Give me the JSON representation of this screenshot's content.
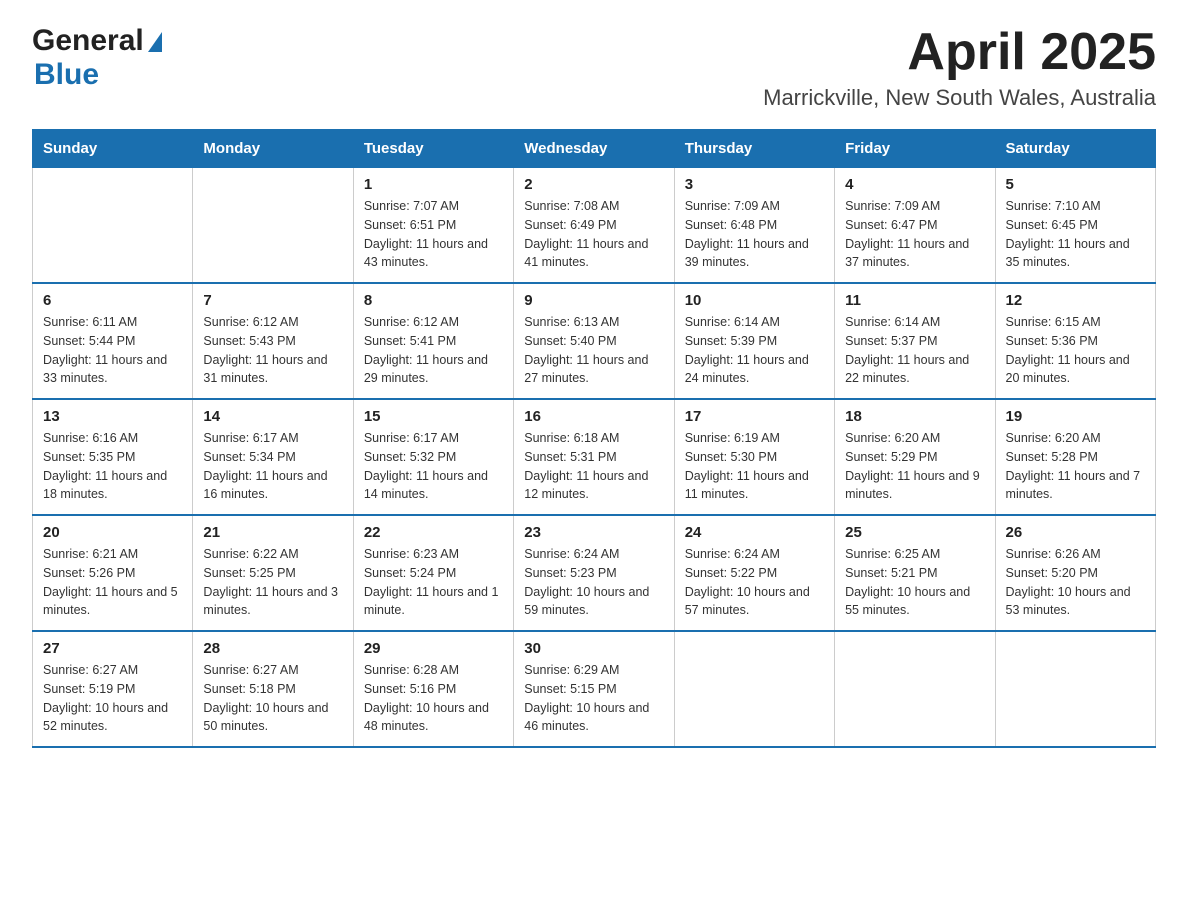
{
  "logo": {
    "general": "General",
    "blue": "Blue"
  },
  "title": "April 2025",
  "subtitle": "Marrickville, New South Wales, Australia",
  "calendar": {
    "headers": [
      "Sunday",
      "Monday",
      "Tuesday",
      "Wednesday",
      "Thursday",
      "Friday",
      "Saturday"
    ],
    "weeks": [
      [
        {
          "day": "",
          "sunrise": "",
          "sunset": "",
          "daylight": ""
        },
        {
          "day": "",
          "sunrise": "",
          "sunset": "",
          "daylight": ""
        },
        {
          "day": "1",
          "sunrise": "Sunrise: 7:07 AM",
          "sunset": "Sunset: 6:51 PM",
          "daylight": "Daylight: 11 hours and 43 minutes."
        },
        {
          "day": "2",
          "sunrise": "Sunrise: 7:08 AM",
          "sunset": "Sunset: 6:49 PM",
          "daylight": "Daylight: 11 hours and 41 minutes."
        },
        {
          "day": "3",
          "sunrise": "Sunrise: 7:09 AM",
          "sunset": "Sunset: 6:48 PM",
          "daylight": "Daylight: 11 hours and 39 minutes."
        },
        {
          "day": "4",
          "sunrise": "Sunrise: 7:09 AM",
          "sunset": "Sunset: 6:47 PM",
          "daylight": "Daylight: 11 hours and 37 minutes."
        },
        {
          "day": "5",
          "sunrise": "Sunrise: 7:10 AM",
          "sunset": "Sunset: 6:45 PM",
          "daylight": "Daylight: 11 hours and 35 minutes."
        }
      ],
      [
        {
          "day": "6",
          "sunrise": "Sunrise: 6:11 AM",
          "sunset": "Sunset: 5:44 PM",
          "daylight": "Daylight: 11 hours and 33 minutes."
        },
        {
          "day": "7",
          "sunrise": "Sunrise: 6:12 AM",
          "sunset": "Sunset: 5:43 PM",
          "daylight": "Daylight: 11 hours and 31 minutes."
        },
        {
          "day": "8",
          "sunrise": "Sunrise: 6:12 AM",
          "sunset": "Sunset: 5:41 PM",
          "daylight": "Daylight: 11 hours and 29 minutes."
        },
        {
          "day": "9",
          "sunrise": "Sunrise: 6:13 AM",
          "sunset": "Sunset: 5:40 PM",
          "daylight": "Daylight: 11 hours and 27 minutes."
        },
        {
          "day": "10",
          "sunrise": "Sunrise: 6:14 AM",
          "sunset": "Sunset: 5:39 PM",
          "daylight": "Daylight: 11 hours and 24 minutes."
        },
        {
          "day": "11",
          "sunrise": "Sunrise: 6:14 AM",
          "sunset": "Sunset: 5:37 PM",
          "daylight": "Daylight: 11 hours and 22 minutes."
        },
        {
          "day": "12",
          "sunrise": "Sunrise: 6:15 AM",
          "sunset": "Sunset: 5:36 PM",
          "daylight": "Daylight: 11 hours and 20 minutes."
        }
      ],
      [
        {
          "day": "13",
          "sunrise": "Sunrise: 6:16 AM",
          "sunset": "Sunset: 5:35 PM",
          "daylight": "Daylight: 11 hours and 18 minutes."
        },
        {
          "day": "14",
          "sunrise": "Sunrise: 6:17 AM",
          "sunset": "Sunset: 5:34 PM",
          "daylight": "Daylight: 11 hours and 16 minutes."
        },
        {
          "day": "15",
          "sunrise": "Sunrise: 6:17 AM",
          "sunset": "Sunset: 5:32 PM",
          "daylight": "Daylight: 11 hours and 14 minutes."
        },
        {
          "day": "16",
          "sunrise": "Sunrise: 6:18 AM",
          "sunset": "Sunset: 5:31 PM",
          "daylight": "Daylight: 11 hours and 12 minutes."
        },
        {
          "day": "17",
          "sunrise": "Sunrise: 6:19 AM",
          "sunset": "Sunset: 5:30 PM",
          "daylight": "Daylight: 11 hours and 11 minutes."
        },
        {
          "day": "18",
          "sunrise": "Sunrise: 6:20 AM",
          "sunset": "Sunset: 5:29 PM",
          "daylight": "Daylight: 11 hours and 9 minutes."
        },
        {
          "day": "19",
          "sunrise": "Sunrise: 6:20 AM",
          "sunset": "Sunset: 5:28 PM",
          "daylight": "Daylight: 11 hours and 7 minutes."
        }
      ],
      [
        {
          "day": "20",
          "sunrise": "Sunrise: 6:21 AM",
          "sunset": "Sunset: 5:26 PM",
          "daylight": "Daylight: 11 hours and 5 minutes."
        },
        {
          "day": "21",
          "sunrise": "Sunrise: 6:22 AM",
          "sunset": "Sunset: 5:25 PM",
          "daylight": "Daylight: 11 hours and 3 minutes."
        },
        {
          "day": "22",
          "sunrise": "Sunrise: 6:23 AM",
          "sunset": "Sunset: 5:24 PM",
          "daylight": "Daylight: 11 hours and 1 minute."
        },
        {
          "day": "23",
          "sunrise": "Sunrise: 6:24 AM",
          "sunset": "Sunset: 5:23 PM",
          "daylight": "Daylight: 10 hours and 59 minutes."
        },
        {
          "day": "24",
          "sunrise": "Sunrise: 6:24 AM",
          "sunset": "Sunset: 5:22 PM",
          "daylight": "Daylight: 10 hours and 57 minutes."
        },
        {
          "day": "25",
          "sunrise": "Sunrise: 6:25 AM",
          "sunset": "Sunset: 5:21 PM",
          "daylight": "Daylight: 10 hours and 55 minutes."
        },
        {
          "day": "26",
          "sunrise": "Sunrise: 6:26 AM",
          "sunset": "Sunset: 5:20 PM",
          "daylight": "Daylight: 10 hours and 53 minutes."
        }
      ],
      [
        {
          "day": "27",
          "sunrise": "Sunrise: 6:27 AM",
          "sunset": "Sunset: 5:19 PM",
          "daylight": "Daylight: 10 hours and 52 minutes."
        },
        {
          "day": "28",
          "sunrise": "Sunrise: 6:27 AM",
          "sunset": "Sunset: 5:18 PM",
          "daylight": "Daylight: 10 hours and 50 minutes."
        },
        {
          "day": "29",
          "sunrise": "Sunrise: 6:28 AM",
          "sunset": "Sunset: 5:16 PM",
          "daylight": "Daylight: 10 hours and 48 minutes."
        },
        {
          "day": "30",
          "sunrise": "Sunrise: 6:29 AM",
          "sunset": "Sunset: 5:15 PM",
          "daylight": "Daylight: 10 hours and 46 minutes."
        },
        {
          "day": "",
          "sunrise": "",
          "sunset": "",
          "daylight": ""
        },
        {
          "day": "",
          "sunrise": "",
          "sunset": "",
          "daylight": ""
        },
        {
          "day": "",
          "sunrise": "",
          "sunset": "",
          "daylight": ""
        }
      ]
    ]
  },
  "colors": {
    "header_bg": "#1a6faf",
    "header_text": "#ffffff",
    "border": "#cccccc",
    "row_border": "#1a6faf"
  }
}
